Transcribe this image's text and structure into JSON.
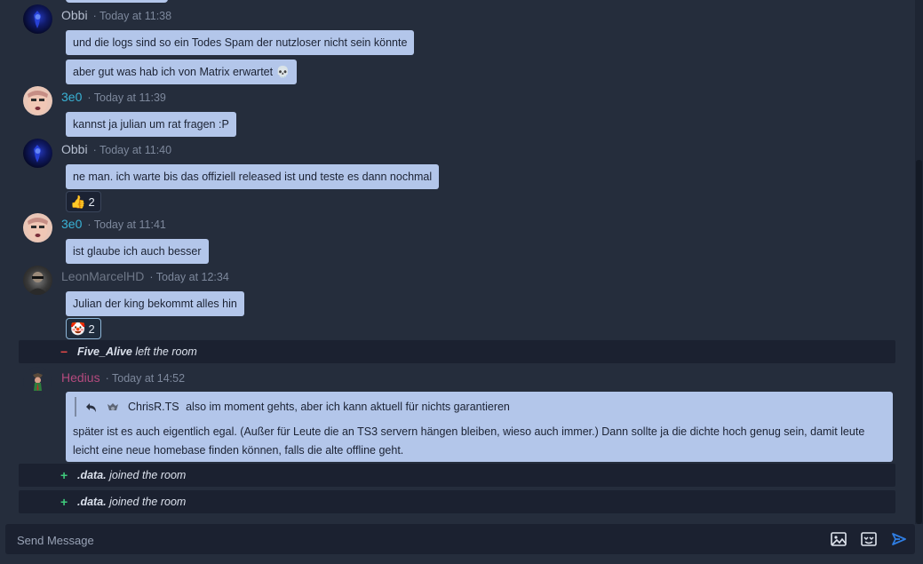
{
  "messages": [
    {
      "sender": "Obbi",
      "timestamp": "Today at 11:38",
      "name_color": "#b6bfd0"
    },
    {
      "sender": "3e0",
      "timestamp": "Today at 11:39",
      "name_color": "#39b3d6"
    },
    {
      "sender": "Obbi",
      "timestamp": "Today at 11:40",
      "name_color": "#b6bfd0"
    },
    {
      "sender": "3e0",
      "timestamp": "Today at 11:41",
      "name_color": "#39b3d6"
    },
    {
      "sender": "LeonMarcelHD",
      "timestamp": "Today at 12:34",
      "name_color": "#6e7787"
    },
    {
      "sender": "Hedius",
      "timestamp": "Today at 14:52",
      "name_color": "#b44a7e"
    }
  ],
  "bubbles": [
    "und die logs sind so ein Todes Spam der nutzloser nicht sein könnte",
    "aber gut was hab ich von Matrix erwartet 💀",
    "kannst ja julian um rat fragen :P",
    "ne man. ich warte bis das offiziell released ist und teste es dann nochmal",
    "ist glaube ich auch besser",
    "Julian der king bekommt alles hin"
  ],
  "reactions": [
    {
      "emoji": "👍",
      "count": "2",
      "icon": "thumbs-up-icon"
    },
    {
      "emoji": "🤡",
      "count": "2",
      "icon": "clown-icon"
    }
  ],
  "events": [
    {
      "sign": "−",
      "user": "Five_Alive",
      "action": "left the room"
    },
    {
      "sign": "+",
      "user": ".data.",
      "action": "joined the room"
    },
    {
      "sign": "+",
      "user": ".data.",
      "action": "joined the room"
    }
  ],
  "reply": {
    "quoted_user": "ChrisR.TS",
    "quoted_text": "also im moment gehts, aber ich kann aktuell für nichts garantieren",
    "body": "später ist es auch eigentlich egal. (Außer für Leute die an TS3 servern hängen bleiben, wieso auch immer.) Dann  sollte ja die dichte hoch genug sein, damit leute leicht eine neue homebase finden können, falls die alte offline geht."
  },
  "composer": {
    "placeholder": "Send Message",
    "image_icon": "image-icon",
    "sticker_icon": "sticker-icon",
    "send_icon": "send-icon"
  },
  "colors": {
    "background": "#252d3c",
    "bubble": "#b3c6ea",
    "event_row": "#1b2130",
    "accent": "#2f7de1"
  }
}
